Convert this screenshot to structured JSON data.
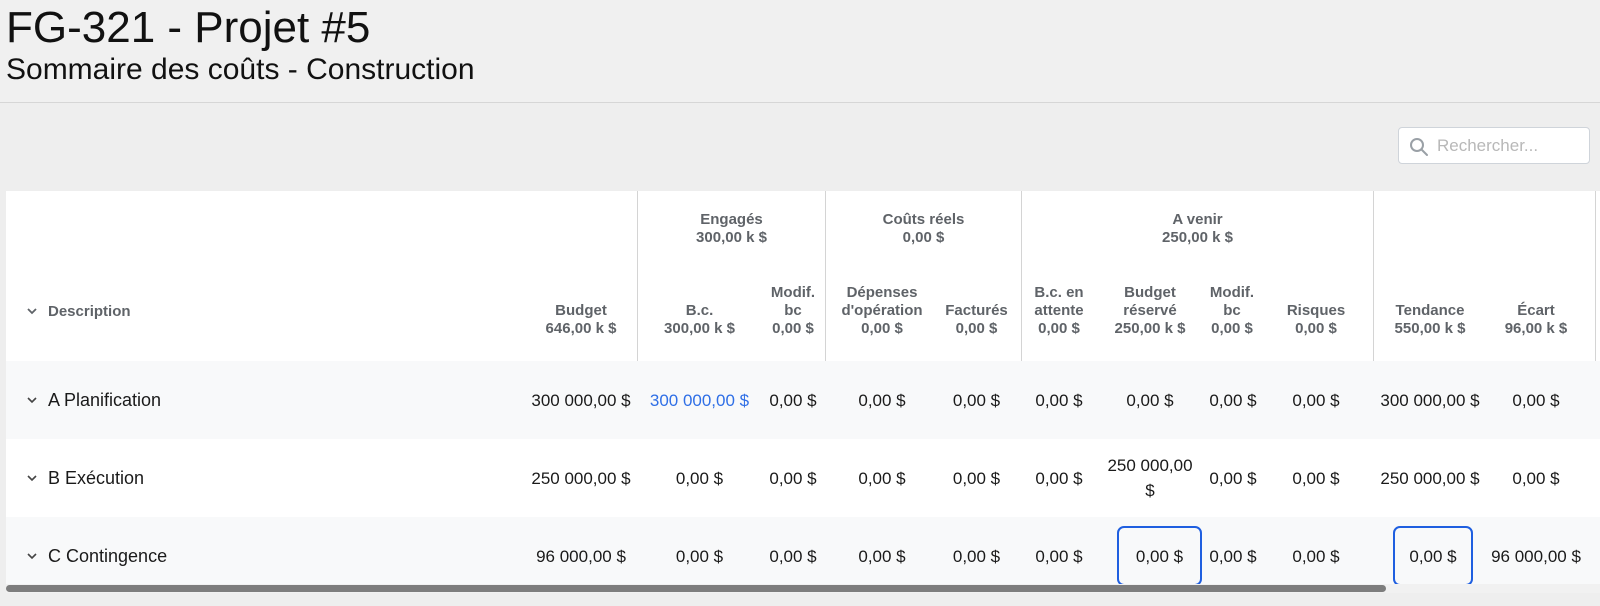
{
  "title": "FG-321 - Projet #5",
  "subtitle": "Sommaire des coûts - Construction",
  "search": {
    "placeholder": "Rechercher..."
  },
  "groups": {
    "engages": {
      "label": "Engagés",
      "total": "300,00 k $"
    },
    "couts": {
      "label": "Coûts réels",
      "total": "0,00 $"
    },
    "avenir": {
      "label": "A venir",
      "total": "250,00 k $"
    }
  },
  "columns": {
    "description": "Description",
    "budget": {
      "label": "Budget",
      "total": "646,00 k $"
    },
    "bc": {
      "label": "B.c.",
      "total": "300,00 k $"
    },
    "modif_bc": {
      "label": "Modif. bc",
      "total": "0,00 $"
    },
    "depenses": {
      "label": "Dépenses d'opération",
      "total": "0,00 $"
    },
    "factures": {
      "label": "Facturés",
      "total": "0,00 $"
    },
    "bc_attente": {
      "label": "B.c. en attente",
      "total": "0,00 $"
    },
    "budget_reserve": {
      "label": "Budget réservé",
      "total": "250,00 k $"
    },
    "modif_bc2": {
      "label": "Modif. bc",
      "total": "0,00 $"
    },
    "risques": {
      "label": "Risques",
      "total": "0,00 $"
    },
    "tendance": {
      "label": "Tendance",
      "total": "550,00 k $"
    },
    "ecart": {
      "label": "Écart",
      "total": "96,00 k $"
    }
  },
  "rows": [
    {
      "label": "A Planification",
      "budget": "300 000,00 $",
      "bc": "300 000,00 $",
      "modif_bc": "0,00 $",
      "depenses": "0,00 $",
      "factures": "0,00 $",
      "bc_attente": "0,00 $",
      "budget_reserve": "0,00 $",
      "modif_bc2": "0,00 $",
      "risques": "0,00 $",
      "tendance": "300 000,00 $",
      "ecart": "0,00 $"
    },
    {
      "label": "B Exécution",
      "budget": "250 000,00 $",
      "bc": "0,00 $",
      "modif_bc": "0,00 $",
      "depenses": "0,00 $",
      "factures": "0,00 $",
      "bc_attente": "0,00 $",
      "budget_reserve": "250 000,00 $",
      "modif_bc2": "0,00 $",
      "risques": "0,00 $",
      "tendance": "250 000,00 $",
      "ecart": "0,00 $"
    },
    {
      "label": "C Contingence",
      "budget": "96 000,00 $",
      "bc": "0,00 $",
      "modif_bc": "0,00 $",
      "depenses": "0,00 $",
      "factures": "0,00 $",
      "bc_attente": "0,00 $",
      "budget_reserve": "0,00 $",
      "modif_bc2": "0,00 $",
      "risques": "0,00 $",
      "tendance": "0,00 $",
      "ecart": "96 000,00 $"
    }
  ],
  "colors": {
    "link": "#2f6fe6",
    "focus_border": "#1f5fe0",
    "header_text": "#5f6368"
  }
}
